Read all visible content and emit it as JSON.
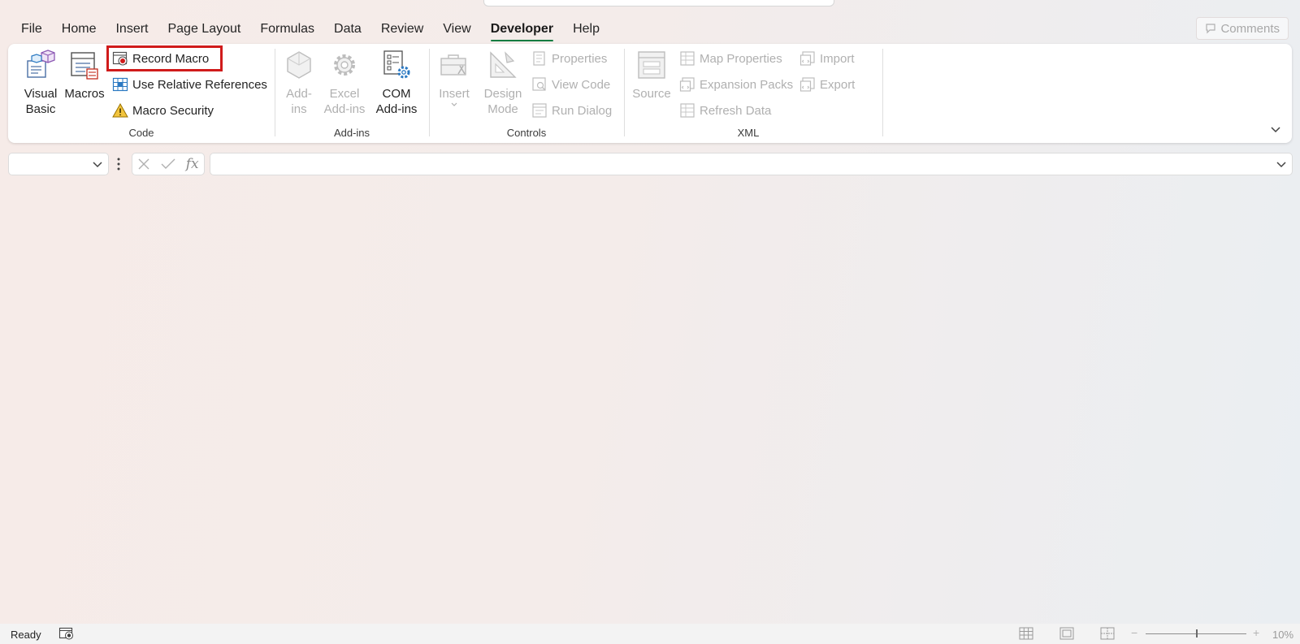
{
  "tabs": [
    {
      "label": "File"
    },
    {
      "label": "Home"
    },
    {
      "label": "Insert"
    },
    {
      "label": "Page Layout"
    },
    {
      "label": "Formulas"
    },
    {
      "label": "Data"
    },
    {
      "label": "Review"
    },
    {
      "label": "View"
    },
    {
      "label": "Developer",
      "active": true
    },
    {
      "label": "Help"
    }
  ],
  "comments_label": "Comments",
  "ribbon": {
    "code": {
      "label": "Code",
      "visual_basic_line1": "Visual",
      "visual_basic_line2": "Basic",
      "macros": "Macros",
      "record_macro": "Record Macro",
      "use_relative_references": "Use Relative References",
      "macro_security": "Macro Security"
    },
    "addins": {
      "label": "Add-ins",
      "addins_line1": "Add-",
      "addins_line2": "ins",
      "excel_addins_line1": "Excel",
      "excel_addins_line2": "Add-ins",
      "com_addins_line1": "COM",
      "com_addins_line2": "Add-ins"
    },
    "controls": {
      "label": "Controls",
      "insert": "Insert",
      "design_mode_line1": "Design",
      "design_mode_line2": "Mode",
      "properties": "Properties",
      "view_code": "View Code",
      "run_dialog": "Run Dialog"
    },
    "xml": {
      "label": "XML",
      "source": "Source",
      "map_properties": "Map Properties",
      "expansion_packs": "Expansion Packs",
      "refresh_data": "Refresh Data",
      "import": "Import",
      "export": "Export"
    }
  },
  "formula_bar": {
    "name_box_value": "",
    "formula_value": "",
    "fx_label": "fx"
  },
  "status": {
    "ready": "Ready",
    "zoom_level": "10%",
    "zoom_minus": "−",
    "zoom_plus": "+"
  },
  "colors": {
    "accent": "#107c41",
    "highlight": "#d01b1b",
    "disabled_text": "#b0b0b0"
  }
}
